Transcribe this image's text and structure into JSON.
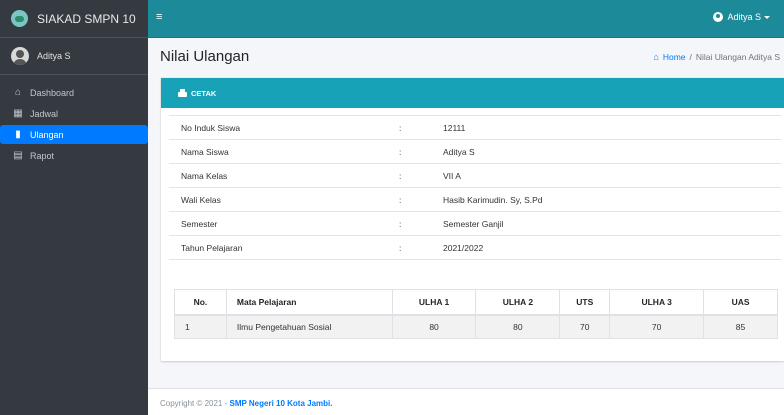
{
  "brand": {
    "title": "SIAKAD SMPN 10"
  },
  "user": {
    "name": "Aditya S"
  },
  "topbar": {
    "user_label": "Aditya S"
  },
  "sidebar": {
    "items": [
      {
        "label": "Dashboard",
        "icon": "home-icon"
      },
      {
        "label": "Jadwal",
        "icon": "calendar-icon"
      },
      {
        "label": "Ulangan",
        "icon": "file-icon"
      },
      {
        "label": "Rapot",
        "icon": "document-icon"
      }
    ],
    "active": "Ulangan",
    "active_color": "#007bff"
  },
  "header": {
    "title": "Nilai Ulangan",
    "breadcrumb_home": "Home",
    "breadcrumb_current": "Nilai Ulangan Aditya S"
  },
  "card": {
    "print_label": "CETAK",
    "header_color": "#17a2b8"
  },
  "info": [
    {
      "label": "No Induk Siswa",
      "value": "12111"
    },
    {
      "label": "Nama Siswa",
      "value": "Aditya S"
    },
    {
      "label": "Nama Kelas",
      "value": "VII A"
    },
    {
      "label": "Wali Kelas",
      "value": "Hasib Karimudin. Sy, S.Pd"
    },
    {
      "label": "Semester",
      "value": "Semester Ganjil"
    },
    {
      "label": "Tahun Pelajaran",
      "value": "2021/2022"
    }
  ],
  "grades": {
    "headers": [
      "No.",
      "Mata Pelajaran",
      "ULHA 1",
      "ULHA 2",
      "UTS",
      "ULHA 3",
      "UAS"
    ],
    "rows": [
      [
        "1",
        "Ilmu Pengetahuan Sosial",
        "80",
        "80",
        "70",
        "70",
        "85"
      ]
    ]
  },
  "footer": {
    "prefix": "Copyright © 2021 - ",
    "link": "SMP Negeri 10 Kota Jambi."
  }
}
